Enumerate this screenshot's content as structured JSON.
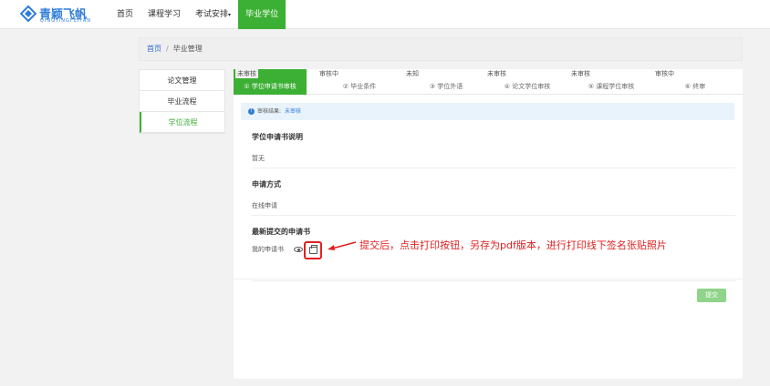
{
  "brand": {
    "name": "青颖飞帆",
    "sub": "QINGYINGFEIFAN"
  },
  "nav": {
    "items": [
      {
        "label": "首页"
      },
      {
        "label": "课程学习"
      },
      {
        "label": "考试安排"
      },
      {
        "label": "毕业学位"
      }
    ],
    "caret": "▾"
  },
  "breadcrumb": {
    "home": "首页",
    "sep": "/",
    "current": "毕业管理"
  },
  "sidebar": {
    "items": [
      {
        "label": "论文管理"
      },
      {
        "label": "毕业流程"
      },
      {
        "label": "学位流程"
      }
    ]
  },
  "steps": [
    {
      "status": "未审核",
      "label": "① 学位申请书审核"
    },
    {
      "status": "审核中",
      "label": "② 毕业条件"
    },
    {
      "status": "未知",
      "label": "③ 学位外语"
    },
    {
      "status": "未审核",
      "label": "④ 论文学位审核"
    },
    {
      "status": "未审核",
      "label": "⑤ 课程学位审核"
    },
    {
      "status": "审核中",
      "label": "⑥ 终审"
    }
  ],
  "alert": {
    "label": "审核结果:",
    "value": "未审核",
    "icon": "!"
  },
  "sections": {
    "explain": {
      "title": "学位申请书说明",
      "body": "暂无"
    },
    "method": {
      "title": "申请方式",
      "body": "在线申请"
    },
    "latest": {
      "title": "最新提交的申请书",
      "body": "我的申请书"
    }
  },
  "annotation": {
    "text": "提交后，点击打印按钮，另存为pdf版本，进行打印线下签名张贴照片"
  },
  "submit": {
    "label": "提交"
  },
  "colors": {
    "accent": "#3cb034",
    "link": "#2f7dd8",
    "annotation": "#e02020"
  }
}
